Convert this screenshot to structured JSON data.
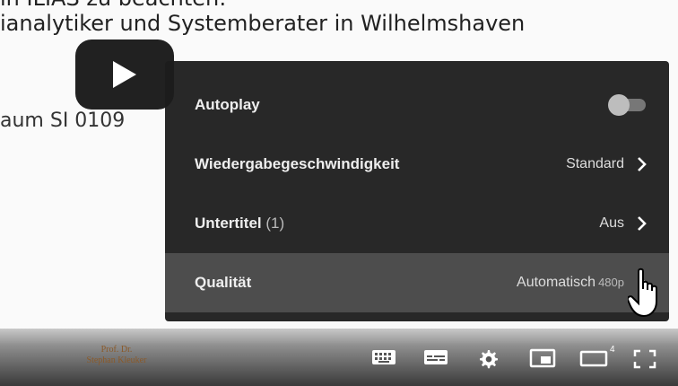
{
  "slide": {
    "top_fragment": "in ILIAS zu beachten:",
    "title_line": "ianalytiker und Systemberater in Wilhelmshaven",
    "room_line": "aum SI 0109"
  },
  "settings_menu": {
    "items": [
      {
        "label": "Autoplay",
        "type": "toggle",
        "toggle_on": false
      },
      {
        "label": "Wiedergabegeschwindigkeit",
        "value": "Standard"
      },
      {
        "label": "Untertitel",
        "label_extra": "(1)",
        "value": "Aus"
      },
      {
        "label": "Qualität",
        "value": "Automatisch",
        "value_sub": "480p",
        "highlighted": true
      }
    ]
  },
  "player": {
    "footer_name_line1": "Prof. Dr.",
    "footer_name_line2": "Stephan Kleuker",
    "controls": [
      "keyboard-icon",
      "subtitles-icon",
      "settings-gear-icon",
      "miniplayer-icon",
      "theater-mode-icon",
      "fullscreen-icon"
    ],
    "badge_text": "4"
  },
  "colors": {
    "menu_bg": "#1c1c1c",
    "menu_highlight": "#4d4d4d",
    "menu_text": "#eeeeee"
  }
}
